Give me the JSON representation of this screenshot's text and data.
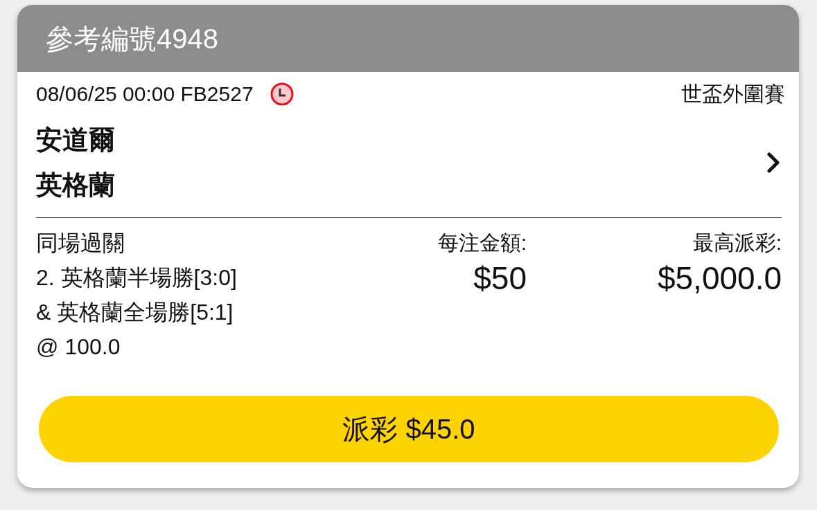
{
  "header": {
    "title": "參考編號4948"
  },
  "match": {
    "datetime_code": "08/06/25 00:00 FB2527",
    "competition": "世盃外圍賽",
    "teams": [
      "安道爾",
      "英格蘭"
    ]
  },
  "bet": {
    "type": "同場過關",
    "selections": [
      "2. 英格蘭半場勝[3:0]",
      "& 英格蘭全場勝[5:1]"
    ],
    "odds": "@ 100.0",
    "stake_label": "每注金額:",
    "stake": "$50",
    "max_payout_label": "最高派彩:",
    "max_payout": "$5,000.0"
  },
  "payout_button": {
    "label": "派彩 $45.0"
  }
}
